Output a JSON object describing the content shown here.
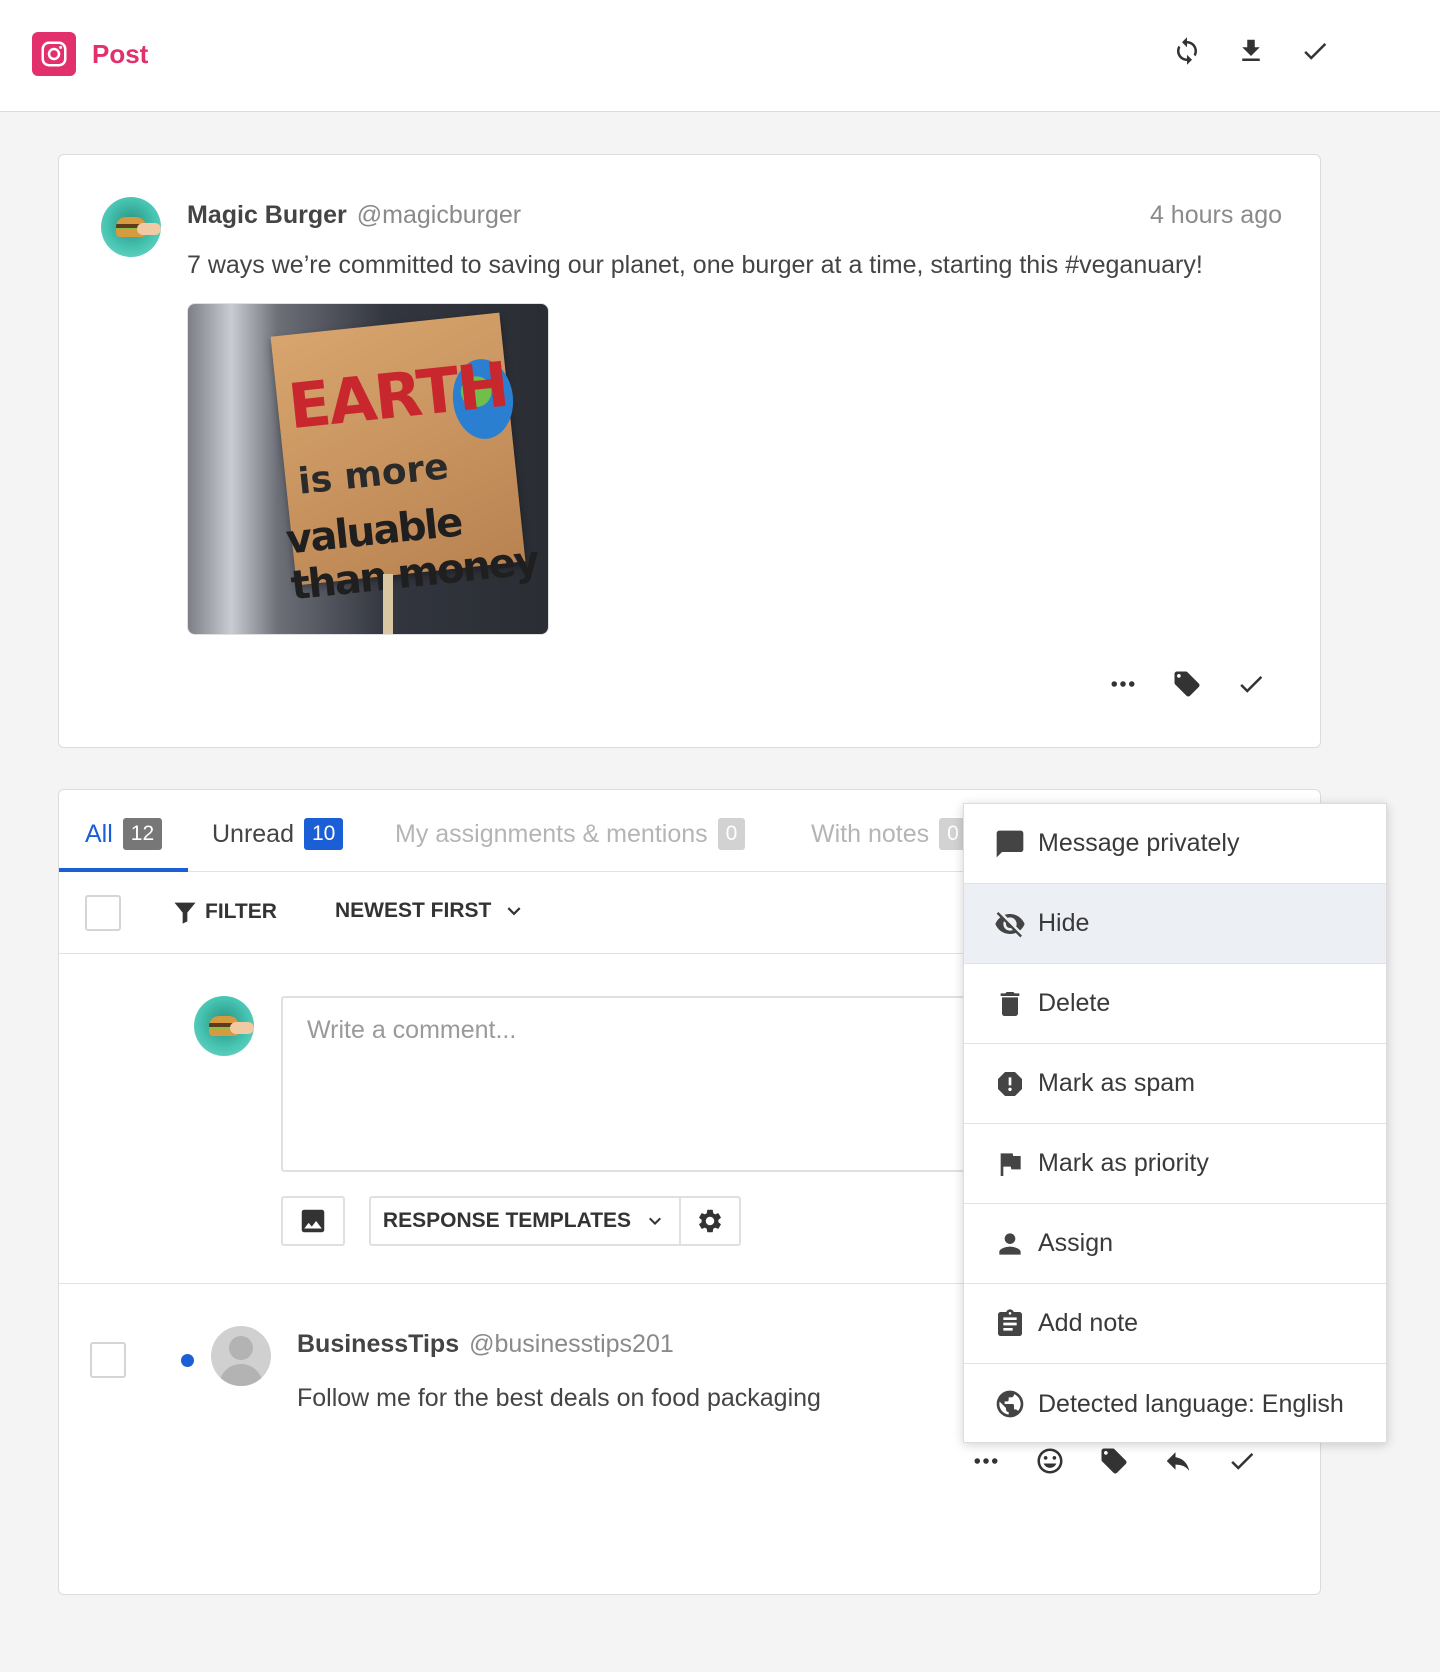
{
  "header": {
    "title": "Post",
    "brand_icon": "instagram-icon",
    "accent_color": "#e1306c",
    "actions": [
      "refresh-icon",
      "download-icon",
      "check-icon"
    ]
  },
  "post": {
    "author_name": "Magic Burger",
    "author_handle": "@magicburger",
    "time": "4 hours ago",
    "text": "7 ways we’re committed to saving our planet, one burger at a time, starting this #veganuary!",
    "image_text": {
      "line1": "EARTH",
      "line2": "is more",
      "line3": "valuable than money"
    },
    "actions": [
      "more-icon",
      "tag-icon",
      "check-icon"
    ]
  },
  "tabs": [
    {
      "label": "All",
      "count": "12"
    },
    {
      "label": "Unread",
      "count": "10"
    },
    {
      "label": "My assignments & mentions",
      "count": "0"
    },
    {
      "label": "With notes",
      "count": "0"
    }
  ],
  "toolbar": {
    "filter_label": "FILTER",
    "sort_label": "NEWEST FIRST"
  },
  "composer": {
    "placeholder": "Write a comment...",
    "templates_label": "RESPONSE TEMPLATES"
  },
  "comment": {
    "author_name": "BusinessTips",
    "author_handle": "@businesstips201",
    "text": "Follow me for the best deals on food packaging",
    "actions": [
      "more-icon",
      "smiley-icon",
      "tag-icon",
      "reply-icon",
      "check-icon"
    ]
  },
  "menu": {
    "items": [
      {
        "label": "Message privately",
        "icon": "chat-bubble-icon"
      },
      {
        "label": "Hide",
        "icon": "eye-off-icon"
      },
      {
        "label": "Delete",
        "icon": "trash-icon"
      },
      {
        "label": "Mark as spam",
        "icon": "spam-icon"
      },
      {
        "label": "Mark as priority",
        "icon": "flag-icon"
      },
      {
        "label": "Assign",
        "icon": "person-icon"
      },
      {
        "label": "Add note",
        "icon": "clipboard-icon"
      },
      {
        "label": "Detected language: English",
        "icon": "globe-icon"
      }
    ]
  },
  "colors": {
    "primary_blue": "#1b5fd6",
    "unread_dot": "#1b5fd6"
  }
}
